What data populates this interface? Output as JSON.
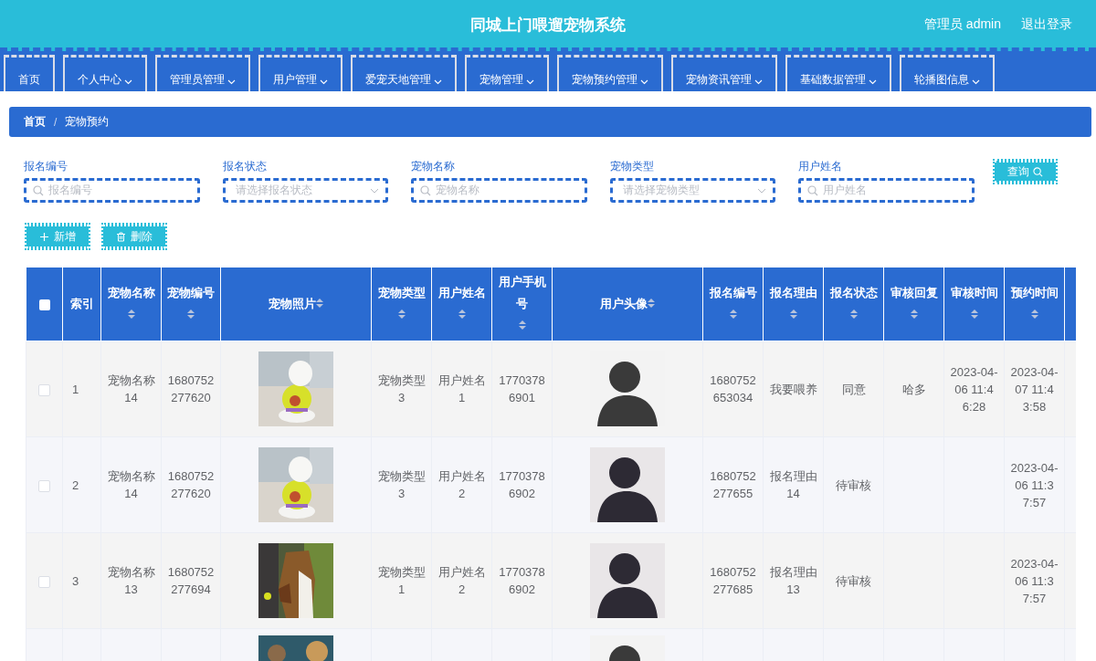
{
  "header": {
    "title": "同城上门喂遛宠物系统",
    "user": "管理员 admin",
    "logout": "退出登录"
  },
  "nav": [
    {
      "label": "首页",
      "dropdown": false
    },
    {
      "label": "个人中心",
      "dropdown": true
    },
    {
      "label": "管理员管理",
      "dropdown": true
    },
    {
      "label": "用户管理",
      "dropdown": true
    },
    {
      "label": "爱宠天地管理",
      "dropdown": true
    },
    {
      "label": "宠物管理",
      "dropdown": true
    },
    {
      "label": "宠物预约管理",
      "dropdown": true
    },
    {
      "label": "宠物资讯管理",
      "dropdown": true
    },
    {
      "label": "基础数据管理",
      "dropdown": true
    },
    {
      "label": "轮播图信息",
      "dropdown": true
    }
  ],
  "breadcrumb": {
    "items": [
      "首页",
      "宠物预约"
    ],
    "separator": "/"
  },
  "filters": [
    {
      "label": "报名编号",
      "placeholder": "报名编号",
      "kind": "search"
    },
    {
      "label": "报名状态",
      "placeholder": "请选择报名状态",
      "kind": "select"
    },
    {
      "label": "宠物名称",
      "placeholder": "宠物名称",
      "kind": "search"
    },
    {
      "label": "宠物类型",
      "placeholder": "请选择宠物类型",
      "kind": "select"
    },
    {
      "label": "用户姓名",
      "placeholder": "用户姓名",
      "kind": "search"
    }
  ],
  "search_button": "查询",
  "actions": [
    {
      "label": "新增",
      "kind": "add"
    },
    {
      "label": "删除",
      "kind": "delete"
    }
  ],
  "table": {
    "select_all": {
      "checked": false
    },
    "columns": [
      {
        "label": "索引",
        "sortable": false,
        "kind": "text"
      },
      {
        "label": "宠物名称",
        "sortable": true,
        "kind": "text"
      },
      {
        "label": "宠物编号",
        "sortable": true,
        "kind": "text"
      },
      {
        "label": "宠物照片",
        "sortable": true,
        "kind": "picture"
      },
      {
        "label": "宠物类型",
        "sortable": true,
        "kind": "text"
      },
      {
        "label": "用户姓名",
        "sortable": true,
        "kind": "text"
      },
      {
        "label": "用户手机号",
        "sortable": true,
        "kind": "text"
      },
      {
        "label": "用户头像",
        "sortable": true,
        "kind": "picture"
      },
      {
        "label": "报名编号",
        "sortable": true,
        "kind": "text"
      },
      {
        "label": "报名理由",
        "sortable": true,
        "kind": "text"
      },
      {
        "label": "报名状态",
        "sortable": true,
        "kind": "text"
      },
      {
        "label": "审核回复",
        "sortable": true,
        "kind": "text"
      },
      {
        "label": "审核时间",
        "sortable": true,
        "kind": "text"
      },
      {
        "label": "预约时间",
        "sortable": true,
        "kind": "text"
      }
    ],
    "rows": [
      {
        "checked": false,
        "cells": [
          "1",
          "宠物名称14",
          "1680752277620",
          {
            "kind": "picture"
          },
          "宠物类型3",
          "用户姓名1",
          "17703786901",
          {
            "kind": "picture"
          },
          "1680752653034",
          "我要喂养",
          "同意",
          "哈多",
          "2023-04-06 11:46:28",
          "2023-04-07 11:43:58"
        ]
      },
      {
        "checked": false,
        "cells": [
          "2",
          "宠物名称14",
          "1680752277620",
          {
            "kind": "picture"
          },
          "宠物类型3",
          "用户姓名2",
          "17703786902",
          {
            "kind": "picture"
          },
          "1680752277655",
          "报名理由14",
          "待审核",
          null,
          null,
          "2023-04-06 11:37:57"
        ]
      },
      {
        "checked": false,
        "cells": [
          "3",
          "宠物名称13",
          "1680752277694",
          {
            "kind": "picture"
          },
          "宠物类型1",
          "用户姓名2",
          "17703786902",
          {
            "kind": "picture"
          },
          "1680752277685",
          "报名理由13",
          "待审核",
          null,
          null,
          "2023-04-06 11:37:57"
        ]
      },
      {
        "cells": [
          null,
          null,
          null,
          {
            "kind": "picture"
          },
          null,
          null,
          null,
          {
            "kind": "picture"
          },
          null,
          null,
          null,
          null,
          null,
          null
        ]
      }
    ]
  }
}
